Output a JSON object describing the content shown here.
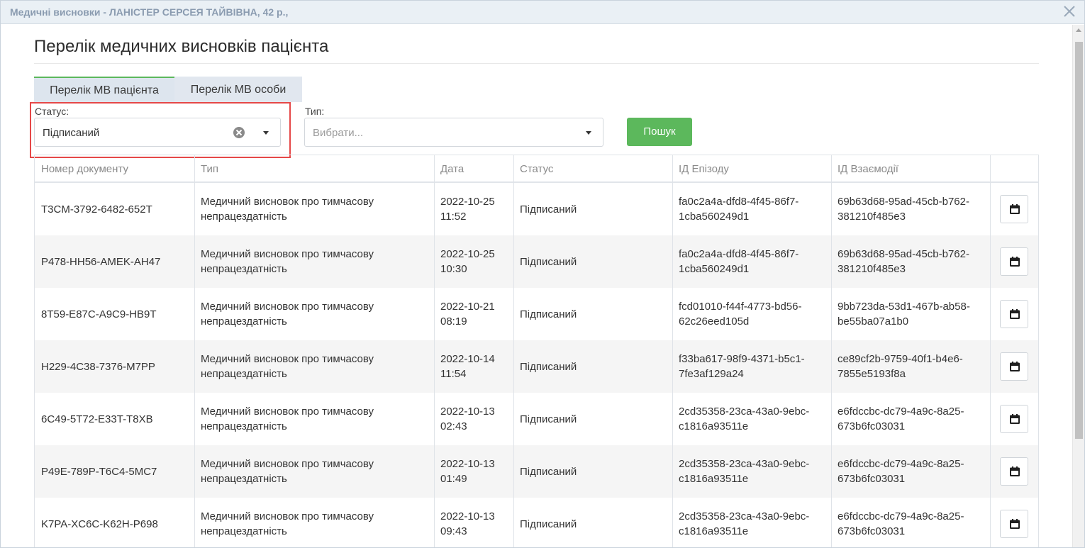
{
  "window": {
    "title": "Медичні висновки - ЛАНІСТЕР СЕРСЕЯ ТАЙВІВНА, 42 р.,",
    "close_icon": "close-icon"
  },
  "page": {
    "title": "Перелік медичних висновків пацієнта"
  },
  "tabs": [
    {
      "label": "Перелік МВ пацієнта",
      "active": true
    },
    {
      "label": "Перелік МВ особи",
      "active": false
    }
  ],
  "filters": {
    "status_label": "Статус:",
    "status_value": "Підписаний",
    "type_label": "Тип:",
    "type_placeholder": "Вибрати...",
    "search_label": "Пошук"
  },
  "colors": {
    "accent_green": "#5cb85c",
    "highlight_red": "#e54848",
    "titlebar_bg": "#eaf0f5"
  },
  "table": {
    "headers": [
      "Номер документу",
      "Тип",
      "Дата",
      "Статус",
      "ІД Епізоду",
      "ІД Взаємодії",
      ""
    ],
    "rows": [
      {
        "number": "T3CM-3792-6482-652T",
        "type_l1": "Медичний висновок про тимчасову",
        "type_l2": "непрацездатність",
        "date": "2022-10-25",
        "time": "11:52",
        "status": "Підписаний",
        "episode_l1": "fa0c2a4a-dfd8-4f45-86f7-",
        "episode_l2": "1cba560249d1",
        "interaction_l1": "69b63d68-95ad-45cb-b762-",
        "interaction_l2": "381210f485e3"
      },
      {
        "number": "P478-HH56-AMEK-AH47",
        "type_l1": "Медичний висновок про тимчасову",
        "type_l2": "непрацездатність",
        "date": "2022-10-25",
        "time": "10:30",
        "status": "Підписаний",
        "episode_l1": "fa0c2a4a-dfd8-4f45-86f7-",
        "episode_l2": "1cba560249d1",
        "interaction_l1": "69b63d68-95ad-45cb-b762-",
        "interaction_l2": "381210f485e3"
      },
      {
        "number": "8T59-E87C-A9C9-HB9T",
        "type_l1": "Медичний висновок про тимчасову",
        "type_l2": "непрацездатність",
        "date": "2022-10-21",
        "time": "08:19",
        "status": "Підписаний",
        "episode_l1": "fcd01010-f44f-4773-bd56-",
        "episode_l2": "62c26eed105d",
        "interaction_l1": "9bb723da-53d1-467b-ab58-",
        "interaction_l2": "be55ba07a1b0"
      },
      {
        "number": "H229-4C38-7376-M7PP",
        "type_l1": "Медичний висновок про тимчасову",
        "type_l2": "непрацездатність",
        "date": "2022-10-14",
        "time": "11:54",
        "status": "Підписаний",
        "episode_l1": "f33ba617-98f9-4371-b5c1-",
        "episode_l2": "7fe3af129a24",
        "interaction_l1": "ce89cf2b-9759-40f1-b4e6-",
        "interaction_l2": "7855e5193f8a"
      },
      {
        "number": "6C49-5T72-E33T-T8XB",
        "type_l1": "Медичний висновок про тимчасову",
        "type_l2": "непрацездатність",
        "date": "2022-10-13",
        "time": "02:43",
        "status": "Підписаний",
        "episode_l1": "2cd35358-23ca-43a0-9ebc-",
        "episode_l2": "c1816a93511e",
        "interaction_l1": "e6fdccbc-dc79-4a9c-8a25-",
        "interaction_l2": "673b6fc03031"
      },
      {
        "number": "P49E-789P-T6C4-5MC7",
        "type_l1": "Медичний висновок про тимчасову",
        "type_l2": "непрацездатність",
        "date": "2022-10-13",
        "time": "01:49",
        "status": "Підписаний",
        "episode_l1": "2cd35358-23ca-43a0-9ebc-",
        "episode_l2": "c1816a93511e",
        "interaction_l1": "e6fdccbc-dc79-4a9c-8a25-",
        "interaction_l2": "673b6fc03031"
      },
      {
        "number": "K7PA-XC6C-K62H-P698",
        "type_l1": "Медичний висновок про тимчасову",
        "type_l2": "непрацездатність",
        "date": "2022-10-13",
        "time": "09:43",
        "status": "Підписаний",
        "episode_l1": "2cd35358-23ca-43a0-9ebc-",
        "episode_l2": "c1816a93511e",
        "interaction_l1": "e6fdccbc-dc79-4a9c-8a25-",
        "interaction_l2": "673b6fc03031"
      }
    ],
    "row_action_icon": "calendar-icon"
  }
}
